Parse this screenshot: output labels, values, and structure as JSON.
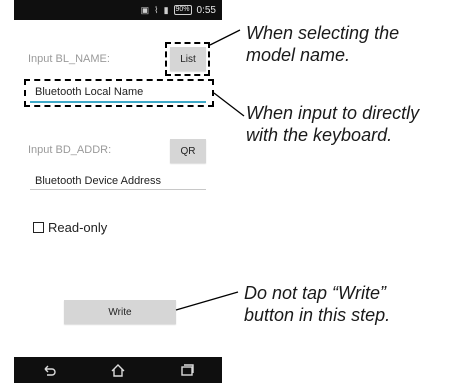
{
  "status_bar": {
    "time": "0:55",
    "battery": "90%",
    "icons": [
      "nfc-icon",
      "vibrate-icon",
      "signal-icon",
      "battery-icon"
    ]
  },
  "form": {
    "bl_name_label": "Input BL_NAME:",
    "list_button": "List",
    "bl_name_value": "Bluetooth Local Name",
    "bd_addr_label": "Input BD_ADDR:",
    "qr_button": "QR",
    "bd_addr_value": "Bluetooth Device Address",
    "readonly_label": "Read-only",
    "readonly_checked": false,
    "write_button": "Write"
  },
  "annotations": {
    "list_note_line1": "When selecting the",
    "list_note_line2": "model name.",
    "input_note_line1": "When input to directly",
    "input_note_line2": "with the keyboard.",
    "write_note_line1": "Do not tap “Write”",
    "write_note_line2": "button in this step."
  },
  "colors": {
    "accent_underline": "#3fa9c8",
    "status_bar_bg": "#0f0f0f"
  }
}
